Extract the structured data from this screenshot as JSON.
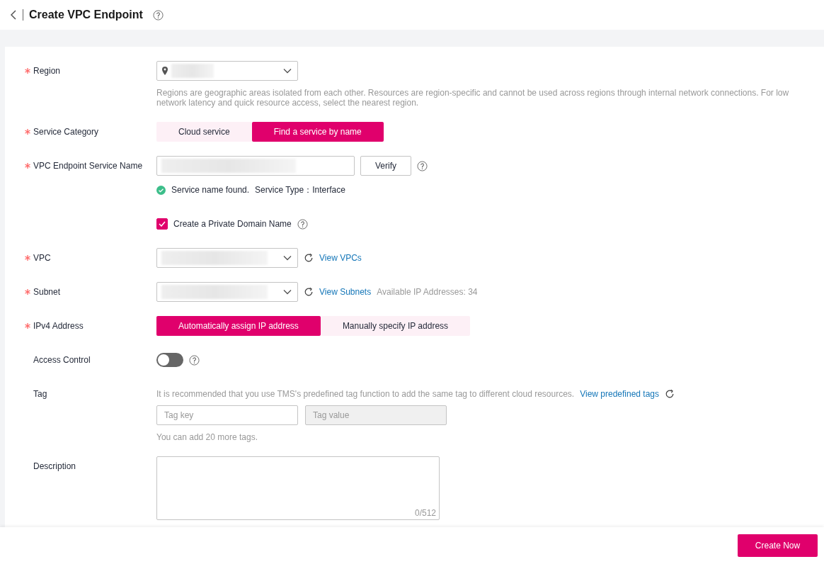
{
  "header": {
    "title": "Create VPC Endpoint"
  },
  "fields": [
    {
      "kind": "region",
      "label": "Region",
      "required": true,
      "hint": "Regions are geographic areas isolated from each other. Resources are region-specific and cannot be used across regions through internal network connections. For low network latency and quick resource access, select the nearest region."
    },
    {
      "kind": "segmented",
      "label": "Service Category",
      "required": true,
      "options": [
        {
          "label": "Cloud service",
          "selected": false
        },
        {
          "label": "Find a service by name",
          "selected": true
        }
      ]
    },
    {
      "kind": "service-name",
      "label": "VPC Endpoint Service Name",
      "required": true,
      "button": "Verify",
      "status": "Service name found.",
      "type_text": "Service Type：Interface"
    },
    {
      "kind": "checkbox",
      "label": "Create a Private Domain Name",
      "checked": true
    },
    {
      "kind": "select",
      "label": "VPC",
      "required": true,
      "link": "View VPCs"
    },
    {
      "kind": "select",
      "label": "Subnet",
      "required": true,
      "link": "View Subnets",
      "note": "Available IP Addresses: 34"
    },
    {
      "kind": "segmented",
      "label": "IPv4 Address",
      "required": true,
      "options": [
        {
          "label": "Automatically assign IP address",
          "selected": true
        },
        {
          "label": "Manually specify IP address",
          "selected": false
        }
      ]
    },
    {
      "kind": "toggle",
      "label": "Access Control",
      "required": false,
      "on": false
    },
    {
      "kind": "tags",
      "label": "Tag",
      "required": false,
      "hint": "It is recommended that you use TMS's predefined tag function to add the same tag to different cloud resources.",
      "link": "View predefined tags",
      "key_placeholder": "Tag key",
      "value_placeholder": "Tag value",
      "value_disabled": true,
      "note": "You can add 20 more tags."
    },
    {
      "kind": "textarea",
      "label": "Description",
      "required": false,
      "counter": "0/512"
    }
  ],
  "footer": {
    "button": "Create Now"
  }
}
